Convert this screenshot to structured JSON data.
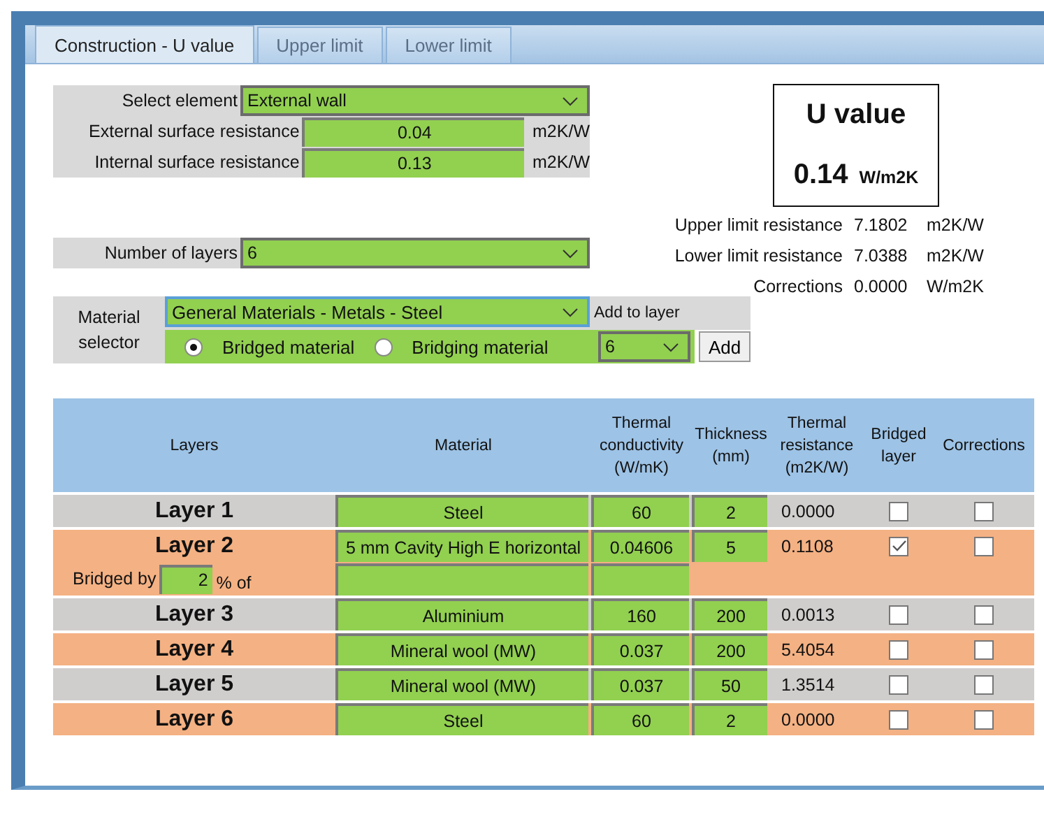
{
  "tabs": [
    {
      "label": "Construction - U value",
      "selected": true
    },
    {
      "label": "Upper limit",
      "selected": false
    },
    {
      "label": "Lower limit",
      "selected": false
    }
  ],
  "element": {
    "label": "Select element",
    "value": "External wall"
  },
  "surface_resistances": [
    {
      "label": "External surface resistance",
      "value": "0.04",
      "unit": "m2K/W"
    },
    {
      "label": "Internal surface resistance",
      "value": "0.13",
      "unit": "m2K/W"
    }
  ],
  "u_value": {
    "title": "U value",
    "value": "0.14",
    "unit": "W/m2K"
  },
  "limits": [
    {
      "label": "Upper limit resistance",
      "value": "7.1802",
      "unit": "m2K/W"
    },
    {
      "label": "Lower limit resistance",
      "value": "7.0388",
      "unit": "m2K/W"
    },
    {
      "label": "Corrections",
      "value": "0.0000",
      "unit": "W/m2K"
    }
  ],
  "number_of_layers": {
    "label": "Number of layers",
    "value": "6"
  },
  "material_selector": {
    "label": "Material selector",
    "material": "General Materials - Metals - Steel",
    "add_to_layer": "Add to layer",
    "options": [
      {
        "label": "Bridged material",
        "selected": true
      },
      {
        "label": "Bridging material",
        "selected": false
      }
    ],
    "layer": "6",
    "add_button": "Add"
  },
  "table": {
    "columns": [
      "Layers",
      "Material",
      "Thermal conductivity (W/mK)",
      "Thickness (mm)",
      "Thermal resistance (m2K/W)",
      "Bridged layer",
      "Corrections"
    ],
    "rows": [
      {
        "name": "Layer 1",
        "material": "Steel",
        "conductivity": "60",
        "thickness": "2",
        "resistance": "0.0000",
        "bridged_layer": false,
        "corrections": false
      },
      {
        "name": "Layer 2",
        "material": "5 mm Cavity High E horizontal",
        "conductivity": "0.04606",
        "thickness": "5",
        "resistance": "0.1108",
        "bridged_layer": true,
        "corrections": false,
        "bridged_by": {
          "label": "Bridged by",
          "value": "2",
          "suffix": "% of"
        }
      },
      {
        "name": "Layer 3",
        "material": "Aluminium",
        "conductivity": "160",
        "thickness": "200",
        "resistance": "0.0013",
        "bridged_layer": false,
        "corrections": false
      },
      {
        "name": "Layer 4",
        "material": "Mineral wool (MW)",
        "conductivity": "0.037",
        "thickness": "200",
        "resistance": "5.4054",
        "bridged_layer": false,
        "corrections": false
      },
      {
        "name": "Layer 5",
        "material": "Mineral wool (MW)",
        "conductivity": "0.037",
        "thickness": "50",
        "resistance": "1.3514",
        "bridged_layer": false,
        "corrections": false
      },
      {
        "name": "Layer 6",
        "material": "Steel",
        "conductivity": "60",
        "thickness": "2",
        "resistance": "0.0000",
        "bridged_layer": false,
        "corrections": false
      }
    ]
  }
}
